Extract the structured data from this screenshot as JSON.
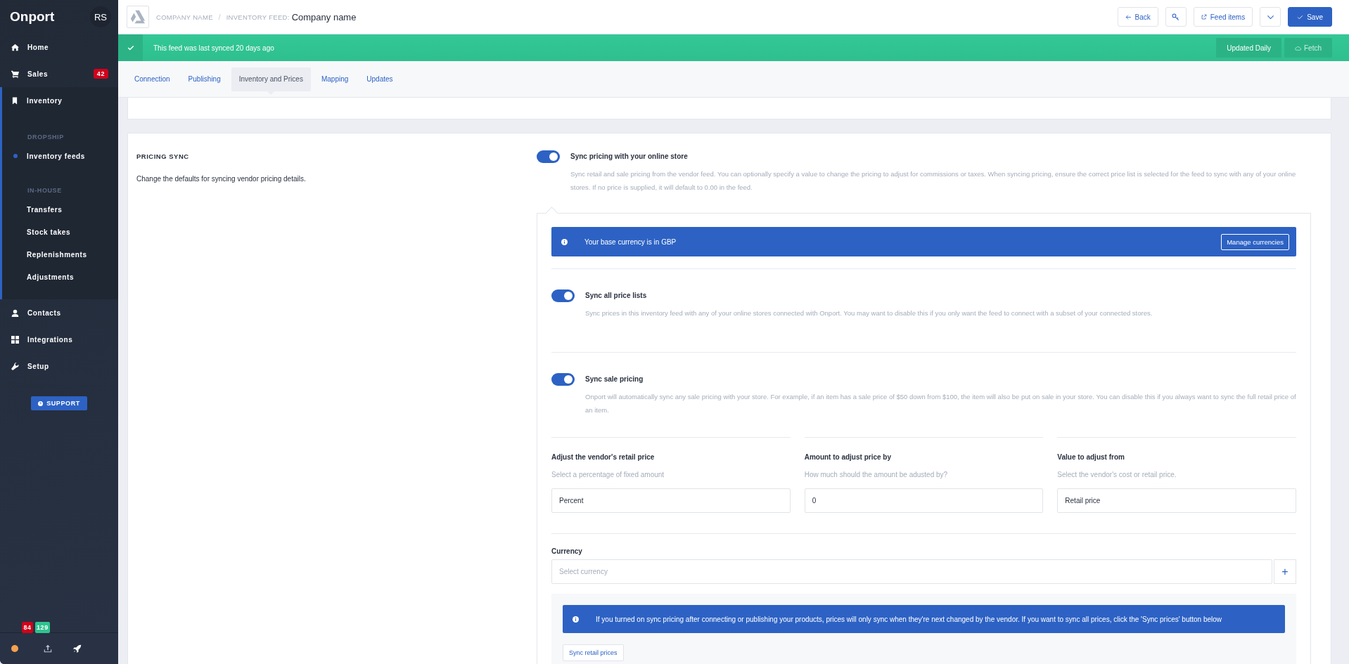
{
  "sidebar": {
    "brand": "Onport",
    "avatar": "RS",
    "items": [
      {
        "label": "Home",
        "selected": false
      },
      {
        "label": "Sales",
        "badge": "42",
        "selected": false
      },
      {
        "label": "Inventory",
        "selected": true,
        "children": [
          {
            "kind": "heading",
            "label": "DROPSHIP"
          },
          {
            "kind": "link",
            "label": "Inventory feeds",
            "selected": true
          },
          {
            "kind": "heading",
            "label": "IN-HOUSE"
          },
          {
            "kind": "link",
            "label": "Transfers",
            "selected": false
          },
          {
            "kind": "link",
            "label": "Stock takes",
            "selected": false
          },
          {
            "kind": "link",
            "label": "Replenishments",
            "selected": false
          },
          {
            "kind": "link",
            "label": "Adjustments",
            "selected": false
          }
        ]
      },
      {
        "label": "Contacts",
        "selected": false
      },
      {
        "label": "Integrations",
        "selected": false
      },
      {
        "label": "Setup",
        "selected": false
      }
    ],
    "support_button": "SUPPORT",
    "footer": {
      "badges": [
        {
          "text": "84",
          "color": "#d0021b"
        },
        {
          "text": "129",
          "color": "#2fc38f"
        }
      ]
    }
  },
  "header": {
    "breadcrumb": [
      "COMPANY NAME",
      "INVENTORY FEED:"
    ],
    "breadcrumb_separator": "/",
    "title": "Company name",
    "buttons": [
      {
        "kind": "back",
        "label": "Back"
      },
      {
        "kind": "key"
      },
      {
        "kind": "external",
        "label": "Feed items"
      },
      {
        "kind": "caret"
      },
      {
        "kind": "save",
        "label": "Save"
      }
    ]
  },
  "sync_bar": {
    "message": "This feed was last synced 20 days ago",
    "buttons": [
      {
        "kind": "plain",
        "label": "Updated Daily"
      },
      {
        "kind": "cloud",
        "label": "Fetch"
      }
    ]
  },
  "tabs": [
    {
      "label": "Connection",
      "selected": false
    },
    {
      "label": "Publishing",
      "selected": false
    },
    {
      "label": "Inventory and Prices",
      "selected": true
    },
    {
      "label": "Mapping",
      "selected": false
    },
    {
      "label": "Updates",
      "selected": false
    }
  ],
  "pricing": {
    "heading": "PRICING SYNC",
    "description": "Change the defaults for syncing vendor pricing details.",
    "main_toggle": {
      "label": "Sync pricing with your online store",
      "description": "Sync retail and sale pricing from the vendor feed. You can optionally specify a value to change the pricing to adjust for commissions or taxes. When syncing pricing, ensure the correct price list is selected for the feed to sync with any of your online stores. If no price is supplied, it will default to 0.00 in the feed.",
      "on": true
    },
    "currency_notice": {
      "text": "Your base currency is in GBP",
      "button": "Manage currencies"
    },
    "toggles": [
      {
        "label": "Sync all price lists",
        "description": "Sync prices in this inventory feed with any of your online stores connected with Onport. You may want to disable this if you only want the feed to connect with a subset of your connected stores.",
        "on": true
      },
      {
        "label": "Sync sale pricing",
        "description": "Onport will automatically sync any sale pricing with your store. For example, if an item has a sale price of $50 down from $100, the item will also be put on sale in your store. You can disable this if you always want to sync the full retail price of an item.",
        "on": true
      }
    ],
    "adjust_fields": [
      {
        "label": "Adjust the vendor's retail price",
        "hint": "Select a percentage of fixed amount",
        "value": "Percent"
      },
      {
        "label": "Amount to adjust price by",
        "hint": "How much should the amount be adusted by?",
        "value": "0"
      },
      {
        "label": "Value to adjust from",
        "hint": "Select the vendor's cost or retail price.",
        "value": "Retail price"
      }
    ],
    "currency": {
      "label": "Currency",
      "placeholder": "Select currency",
      "add_button": "+"
    },
    "sync_notice": {
      "text": "If you turned on sync pricing after connecting or publishing your products, prices will only sync when they're next changed by the vendor. If you want to sync all prices, click the 'Sync prices' button below"
    },
    "sync_button": "Sync retail prices"
  }
}
